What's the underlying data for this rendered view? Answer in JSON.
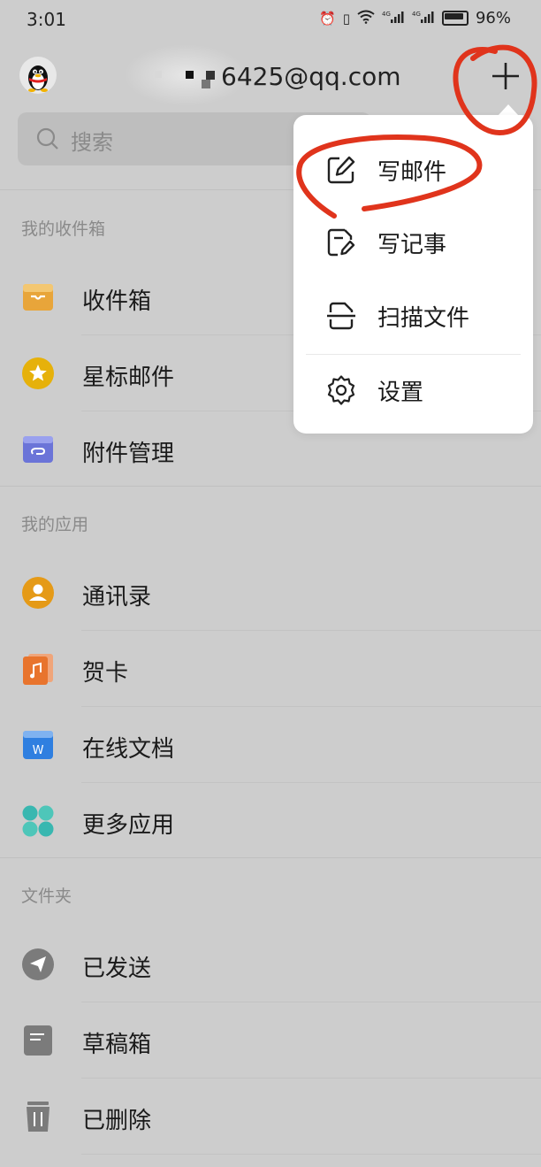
{
  "status_bar": {
    "time": "3:01",
    "network": "4G",
    "battery": "96%"
  },
  "header": {
    "account_email": "6425@qq.com",
    "add_icon": "plus-icon"
  },
  "search": {
    "placeholder": "搜索"
  },
  "sections": [
    {
      "title": "我的收件箱",
      "items": [
        {
          "label": "收件箱",
          "icon": "inbox-icon",
          "color": "#e8a53a"
        },
        {
          "label": "星标邮件",
          "icon": "star-icon",
          "color": "#e6b10a"
        },
        {
          "label": "附件管理",
          "icon": "attachment-icon",
          "color": "#6b74d8"
        }
      ]
    },
    {
      "title": "我的应用",
      "items": [
        {
          "label": "通讯录",
          "icon": "contacts-icon",
          "color": "#e59a17"
        },
        {
          "label": "贺卡",
          "icon": "greeting-card-icon",
          "color": "#e8742d"
        },
        {
          "label": "在线文档",
          "icon": "document-icon",
          "color": "#2f7fe0"
        },
        {
          "label": "更多应用",
          "icon": "more-apps-icon",
          "color": "#39b7b0"
        }
      ]
    },
    {
      "title": "文件夹",
      "items": [
        {
          "label": "已发送",
          "icon": "sent-icon",
          "color": "#7b7b7b"
        },
        {
          "label": "草稿箱",
          "icon": "draft-icon",
          "color": "#7b7b7b"
        },
        {
          "label": "已删除",
          "icon": "trash-icon",
          "color": "#7b7b7b"
        }
      ]
    }
  ],
  "popup_menu": {
    "items": [
      {
        "label": "写邮件",
        "icon": "compose-icon"
      },
      {
        "label": "写记事",
        "icon": "note-icon"
      },
      {
        "label": "扫描文件",
        "icon": "scan-icon"
      },
      {
        "label": "设置",
        "icon": "settings-icon"
      }
    ]
  },
  "colors": {
    "background": "#cdcdcd",
    "popup": "#ffffff",
    "annotation": "#e0341c"
  }
}
